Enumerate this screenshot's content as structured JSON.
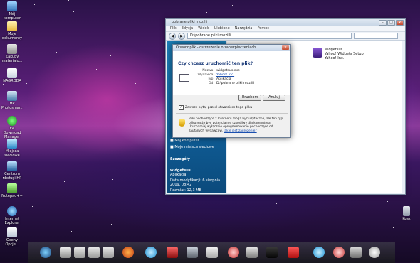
{
  "desktop_icons": [
    {
      "label": "Mój komputer",
      "icon": "computer-icon"
    },
    {
      "label": "Moje dokumenty",
      "icon": "documents-folder-icon"
    },
    {
      "label": "Zakupy materiało...",
      "icon": "shopping-folder-icon"
    },
    {
      "label": "NAGRODA",
      "icon": "document-icon"
    },
    {
      "label": "HP Photosmar...",
      "icon": "hp-printer-icon"
    },
    {
      "label": "EA Download Manager",
      "icon": "ea-icon"
    },
    {
      "label": "Miejsca sieciowe",
      "icon": "network-places-icon"
    },
    {
      "label": "Centrum obsługi HP",
      "icon": "hp-center-icon"
    },
    {
      "label": "Notepad++",
      "icon": "notepad-icon"
    },
    {
      "label": "Internet Explorer",
      "icon": "ie-icon"
    },
    {
      "label": "Oceny Opcje...",
      "icon": "document-icon"
    }
  ],
  "trash_label": "Kosz",
  "explorer": {
    "title": "pobrane pliki mozilli",
    "menu": [
      "Plik",
      "Edycja",
      "Widok",
      "Ulubione",
      "Narzędzia",
      "Pomoc"
    ],
    "address": "D:\\pobrane pliki mozilli",
    "sidebar_links": [
      "Mój komputer",
      "Moje miejsca sieciowe"
    ],
    "details_heading": "Szczegóły",
    "details_name": "widgetsus",
    "details_type": "Aplikacja",
    "details_date": "Data modyfikacji: 6 sierpnia 2009, 08:42",
    "details_size": "Rozmiar: 12,3 MB",
    "file": {
      "name": "widgetsus",
      "desc": "Yahoo! Widgets Setup",
      "company": "Yahoo! Inc."
    }
  },
  "dialog": {
    "title": "Otwórz plik - ostrzeżenie o zabezpieczeniach",
    "question": "Czy chcesz uruchomić ten plik?",
    "name_label": "Nazwa:",
    "name_value": "widgetsus.exe",
    "publisher_label": "Wydawca:",
    "publisher_value": "Yahoo! Inc.",
    "type_label": "Typ:",
    "type_value": "Aplikacja",
    "from_label": "Od:",
    "from_value": "D:\\pobrane pliki mozilli",
    "run_button": "Uruchom",
    "cancel_button": "Anuluj",
    "checkbox_label": "Zawsze pytaj przed otwarciem tego pliku",
    "checkbox_checked": true,
    "warning_text": "Pliki pochodzące z Internetu mogą być użyteczne, ale ten typ pliku może być potencjalnie szkodliwy dla komputera. Uruchamiaj wyłącznie oprogramowanie pochodzące od zaufanych wydawców.",
    "warning_link": "Jakie jest zagrożenie?"
  },
  "dock_icons": [
    "windows-start-icon",
    "drive-icon",
    "disk-icon",
    "disk-icon",
    "disk-icon",
    "firefox-icon",
    "skype-icon",
    "m-app-icon",
    "network-icon",
    "mail-icon",
    "media-icon",
    "music-icon",
    "dark-app-icon",
    "kaspersky-icon",
    "skype-icon",
    "alarm-icon",
    "arrow-app-icon",
    "clock-icon"
  ]
}
